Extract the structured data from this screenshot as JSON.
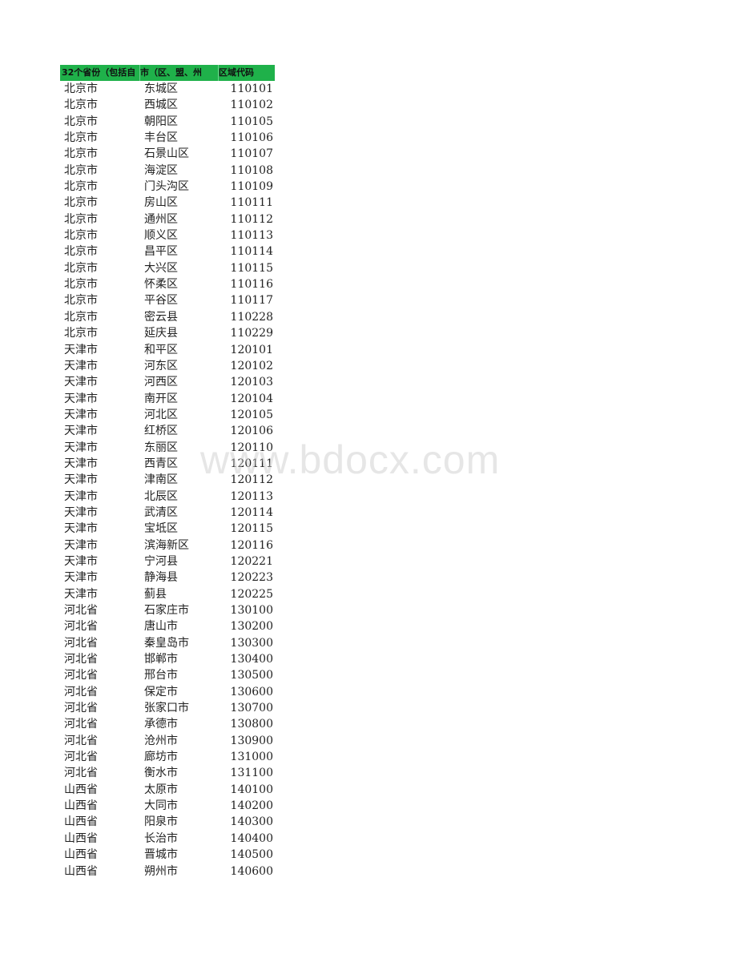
{
  "header": {
    "col1": "32个省份（包括自",
    "col2": "市（区、盟、州",
    "col3": "区域代码"
  },
  "rows": [
    [
      "北京市",
      "东城区",
      "110101"
    ],
    [
      "北京市",
      "西城区",
      "110102"
    ],
    [
      "北京市",
      "朝阳区",
      "110105"
    ],
    [
      "北京市",
      "丰台区",
      "110106"
    ],
    [
      "北京市",
      "石景山区",
      "110107"
    ],
    [
      "北京市",
      "海淀区",
      "110108"
    ],
    [
      "北京市",
      "门头沟区",
      "110109"
    ],
    [
      "北京市",
      "房山区",
      "110111"
    ],
    [
      "北京市",
      "通州区",
      "110112"
    ],
    [
      "北京市",
      "顺义区",
      "110113"
    ],
    [
      "北京市",
      "昌平区",
      "110114"
    ],
    [
      "北京市",
      "大兴区",
      "110115"
    ],
    [
      "北京市",
      "怀柔区",
      "110116"
    ],
    [
      "北京市",
      "平谷区",
      "110117"
    ],
    [
      "北京市",
      "密云县",
      "110228"
    ],
    [
      "北京市",
      "延庆县",
      "110229"
    ],
    [
      "天津市",
      "和平区",
      "120101"
    ],
    [
      "天津市",
      "河东区",
      "120102"
    ],
    [
      "天津市",
      "河西区",
      "120103"
    ],
    [
      "天津市",
      "南开区",
      "120104"
    ],
    [
      "天津市",
      "河北区",
      "120105"
    ],
    [
      "天津市",
      "红桥区",
      "120106"
    ],
    [
      "天津市",
      "东丽区",
      "120110"
    ],
    [
      "天津市",
      "西青区",
      "120111"
    ],
    [
      "天津市",
      "津南区",
      "120112"
    ],
    [
      "天津市",
      "北辰区",
      "120113"
    ],
    [
      "天津市",
      "武清区",
      "120114"
    ],
    [
      "天津市",
      "宝坻区",
      "120115"
    ],
    [
      "天津市",
      "滨海新区",
      "120116"
    ],
    [
      "天津市",
      "宁河县",
      "120221"
    ],
    [
      "天津市",
      "静海县",
      "120223"
    ],
    [
      "天津市",
      "蓟县",
      "120225"
    ],
    [
      "河北省",
      "石家庄市",
      "130100"
    ],
    [
      "河北省",
      "唐山市",
      "130200"
    ],
    [
      "河北省",
      "秦皇岛市",
      "130300"
    ],
    [
      "河北省",
      "邯郸市",
      "130400"
    ],
    [
      "河北省",
      "邢台市",
      "130500"
    ],
    [
      "河北省",
      "保定市",
      "130600"
    ],
    [
      "河北省",
      "张家口市",
      "130700"
    ],
    [
      "河北省",
      "承德市",
      "130800"
    ],
    [
      "河北省",
      "沧州市",
      "130900"
    ],
    [
      "河北省",
      "廊坊市",
      "131000"
    ],
    [
      "河北省",
      "衡水市",
      "131100"
    ],
    [
      "山西省",
      "太原市",
      "140100"
    ],
    [
      "山西省",
      "大同市",
      "140200"
    ],
    [
      "山西省",
      "阳泉市",
      "140300"
    ],
    [
      "山西省",
      "长治市",
      "140400"
    ],
    [
      "山西省",
      "晋城市",
      "140500"
    ],
    [
      "山西省",
      "朔州市",
      "140600"
    ]
  ],
  "watermark": "www.bdocx.com",
  "colors": {
    "header_bg": "#1fb14a"
  }
}
